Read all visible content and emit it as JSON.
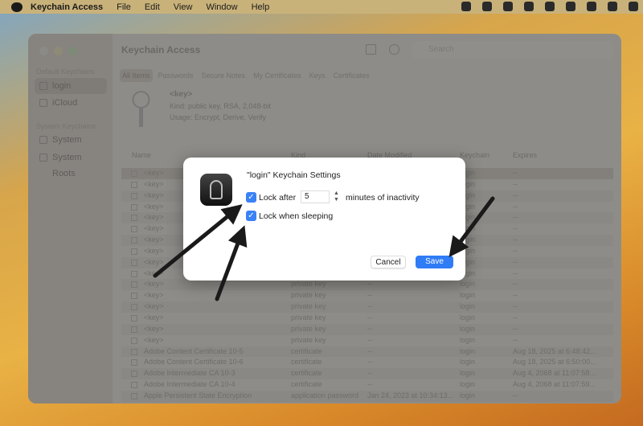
{
  "menubar": {
    "app": "Keychain Access",
    "items": [
      "File",
      "Edit",
      "View",
      "Window",
      "Help"
    ]
  },
  "window": {
    "title": "Keychain Access",
    "search_placeholder": "Search",
    "sidebar": {
      "default_header": "Default Keychains",
      "system_header": "System Keychains",
      "items": [
        {
          "label": "login",
          "selected": true
        },
        {
          "label": "iCloud"
        },
        {
          "label": "System"
        },
        {
          "label": "System Roots"
        }
      ]
    },
    "tabs": [
      {
        "label": "All Items",
        "selected": true
      },
      {
        "label": "Passwords"
      },
      {
        "label": "Secure Notes"
      },
      {
        "label": "My Certificates"
      },
      {
        "label": "Keys"
      },
      {
        "label": "Certificates"
      }
    ],
    "info": {
      "name": "<key>",
      "kind": "Kind:  public key, RSA, 2,048-bit",
      "usage": "Usage:  Encrypt, Derive, Verify"
    },
    "columns": [
      "Name",
      "Kind",
      "Date Modified",
      "Keychain",
      "Expires"
    ],
    "rows": [
      [
        "<key>",
        "",
        "",
        "login",
        "--"
      ],
      [
        "<key>",
        "",
        "",
        "login",
        "--"
      ],
      [
        "<key>",
        "",
        "",
        "login",
        "--"
      ],
      [
        "<key>",
        "",
        "",
        "login",
        "--"
      ],
      [
        "<key>",
        "",
        "",
        "login",
        "--"
      ],
      [
        "<key>",
        "",
        "",
        "login",
        "--"
      ],
      [
        "<key>",
        "",
        "",
        "login",
        "--"
      ],
      [
        "<key>",
        "",
        "",
        "login",
        "--"
      ],
      [
        "<key>",
        "",
        "",
        "login",
        "--"
      ],
      [
        "<key>",
        "",
        "",
        "login",
        "--"
      ],
      [
        "<key>",
        "private key",
        "--",
        "login",
        "--"
      ],
      [
        "<key>",
        "private key",
        "--",
        "login",
        "--"
      ],
      [
        "<key>",
        "private key",
        "--",
        "login",
        "--"
      ],
      [
        "<key>",
        "private key",
        "--",
        "login",
        "--"
      ],
      [
        "<key>",
        "private key",
        "--",
        "login",
        "--"
      ],
      [
        "<key>",
        "private key",
        "--",
        "login",
        "--"
      ],
      [
        "Adobe Content Certificate 10-5",
        "certificate",
        "--",
        "login",
        "Aug 18, 2025 at 6:48:42..."
      ],
      [
        "Adobe Content Certificate 10-6",
        "certificate",
        "--",
        "login",
        "Aug 18, 2025 at 6:50:00..."
      ],
      [
        "Adobe Intermediate CA 10-3",
        "certificate",
        "--",
        "login",
        "Aug 4, 2068 at 11:07:58..."
      ],
      [
        "Adobe Intermediate CA 10-4",
        "certificate",
        "--",
        "login",
        "Aug 4, 2068 at 11:07:59..."
      ],
      [
        "Apple Persistent State Encryption",
        "application password",
        "Jan 24, 2023 at 10:34:13...",
        "login",
        "--"
      ]
    ]
  },
  "dialog": {
    "title": "\"login\" Keychain Settings",
    "lock_after_label": "Lock after",
    "lock_after_checked": true,
    "minutes": "5",
    "minutes_suffix": "minutes of inactivity",
    "lock_sleep_label": "Lock when sleeping",
    "lock_sleep_checked": true,
    "cancel": "Cancel",
    "save": "Save",
    "accent": "#2f7cf6"
  }
}
